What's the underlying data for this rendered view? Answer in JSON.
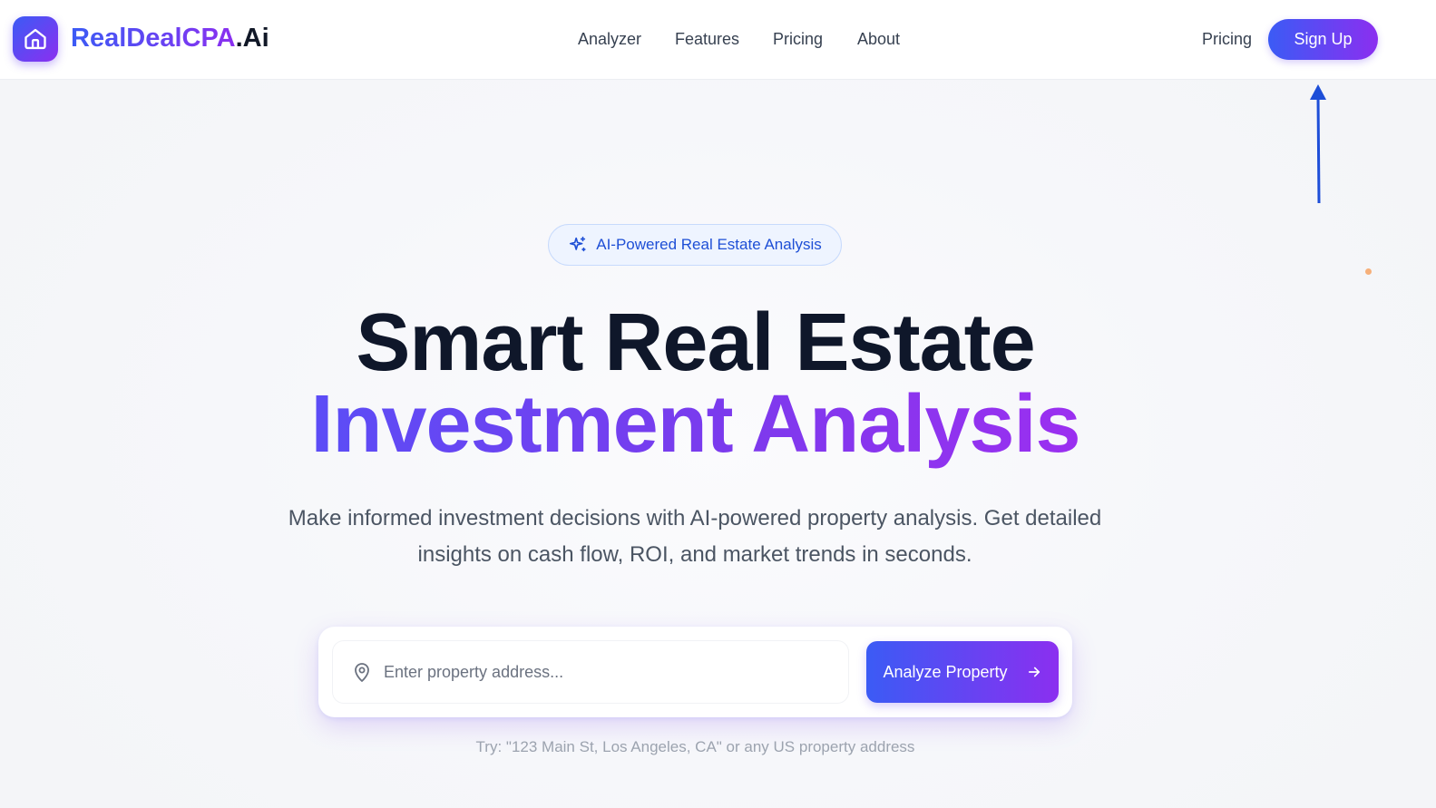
{
  "header": {
    "logo_brand": "RealDealCPA",
    "logo_suffix": ".Ai",
    "nav": {
      "analyzer": "Analyzer",
      "features": "Features",
      "pricing": "Pricing",
      "about": "About"
    },
    "pricing_link": "Pricing",
    "signup_label": "Sign Up"
  },
  "hero": {
    "badge": "AI-Powered Real Estate Analysis",
    "title_line1": "Smart Real Estate",
    "title_line2": "Investment Analysis",
    "subtitle": "Make informed investment decisions with AI-powered property analysis. Get detailed insights on cash flow, ROI, and market trends in seconds."
  },
  "search": {
    "placeholder": "Enter property address...",
    "value": "",
    "button_label": "Analyze Property",
    "hint": "Try: \"123 Main St, Los Angeles, CA\" or any US property address"
  },
  "icons": {
    "logo": "home-icon",
    "badge": "sparkles-icon",
    "input": "map-pin-icon",
    "button": "arrow-right-icon"
  },
  "colors": {
    "brand_gradient_start": "#3b5bf5",
    "brand_gradient_end": "#8b2ff0",
    "annotation_arrow": "#1d4ed8"
  }
}
